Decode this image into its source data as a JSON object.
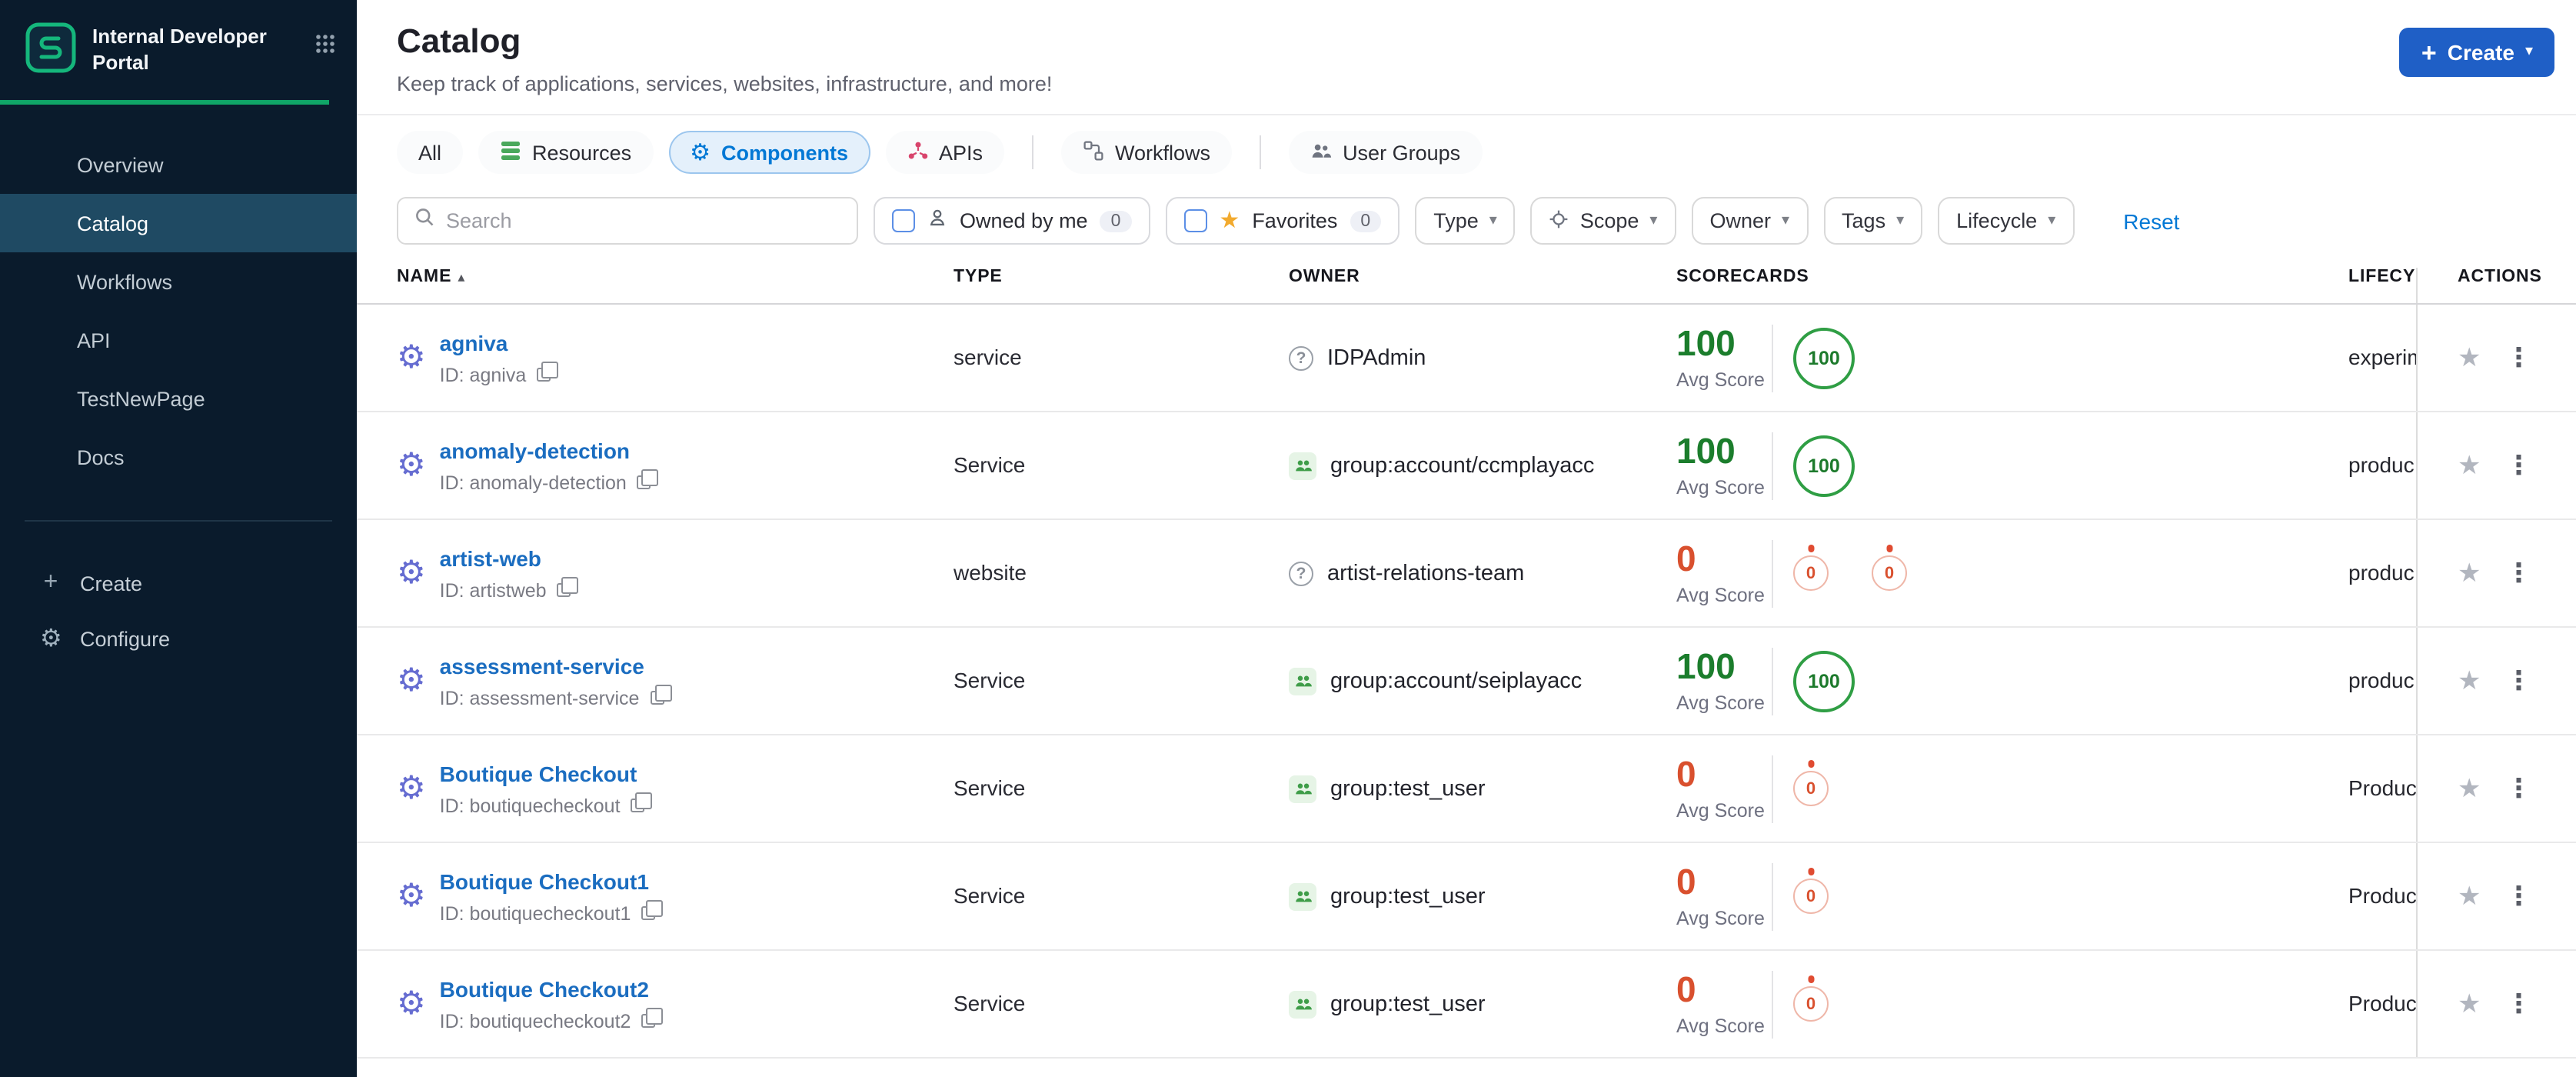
{
  "sidebar": {
    "logo_title_line1": "Internal Developer",
    "logo_title_line2": "Portal",
    "items": [
      {
        "label": "Overview",
        "active": false
      },
      {
        "label": "Catalog",
        "active": true
      },
      {
        "label": "Workflows",
        "active": false
      },
      {
        "label": "API",
        "active": false
      },
      {
        "label": "TestNewPage",
        "active": false
      },
      {
        "label": "Docs",
        "active": false
      }
    ],
    "create_label": "Create",
    "configure_label": "Configure"
  },
  "header": {
    "title": "Catalog",
    "subtitle": "Keep track of applications, services, websites, infrastructure, and more!",
    "create_button_label": "Create"
  },
  "tabs": [
    {
      "label": "All",
      "active": false
    },
    {
      "label": "Resources",
      "active": false
    },
    {
      "label": "Components",
      "active": true
    },
    {
      "label": "APIs",
      "active": false
    },
    {
      "label": "Workflows",
      "active": false
    },
    {
      "label": "User Groups",
      "active": false
    }
  ],
  "filters": {
    "search_placeholder": "Search",
    "owned_by_me": {
      "label": "Owned by me",
      "count": "0"
    },
    "favorites": {
      "label": "Favorites",
      "count": "0"
    },
    "dropdowns": [
      {
        "label": "Type"
      },
      {
        "label": "Scope"
      },
      {
        "label": "Owner"
      },
      {
        "label": "Tags"
      },
      {
        "label": "Lifecycle"
      }
    ],
    "reset_label": "Reset"
  },
  "table": {
    "columns": [
      "NAME",
      "TYPE",
      "OWNER",
      "SCORECARDS",
      "LIFECYC",
      "ACTIONS"
    ],
    "avg_score_label": "Avg Score",
    "rows": [
      {
        "name": "agniva",
        "id": "ID: agniva",
        "type": "service",
        "owner": "IDPAdmin",
        "owner_icon": "question",
        "avg_score": "100",
        "score_variant": "green",
        "badges": [
          {
            "value": "100",
            "variant": "green"
          }
        ],
        "lifecycle": "experim"
      },
      {
        "name": "anomaly-detection",
        "id": "ID: anomaly-detection",
        "type": "Service",
        "owner": "group:account/ccmplayacc",
        "owner_icon": "group",
        "avg_score": "100",
        "score_variant": "green",
        "badges": [
          {
            "value": "100",
            "variant": "green"
          }
        ],
        "lifecycle": "produc"
      },
      {
        "name": "artist-web",
        "id": "ID: artistweb",
        "type": "website",
        "owner": "artist-relations-team",
        "owner_icon": "question",
        "avg_score": "0",
        "score_variant": "red",
        "badges": [
          {
            "value": "0",
            "variant": "red"
          },
          {
            "value": "0",
            "variant": "red"
          }
        ],
        "lifecycle": "produc"
      },
      {
        "name": "assessment-service",
        "id": "ID: assessment-service",
        "type": "Service",
        "owner": "group:account/seiplayacc",
        "owner_icon": "group",
        "avg_score": "100",
        "score_variant": "green",
        "badges": [
          {
            "value": "100",
            "variant": "green"
          }
        ],
        "lifecycle": "produc"
      },
      {
        "name": "Boutique Checkout",
        "id": "ID: boutiquecheckout",
        "type": "Service",
        "owner": "group:test_user",
        "owner_icon": "group",
        "avg_score": "0",
        "score_variant": "red",
        "badges": [
          {
            "value": "0",
            "variant": "red"
          }
        ],
        "lifecycle": "Produc"
      },
      {
        "name": "Boutique Checkout1",
        "id": "ID: boutiquecheckout1",
        "type": "Service",
        "owner": "group:test_user",
        "owner_icon": "group",
        "avg_score": "0",
        "score_variant": "red",
        "badges": [
          {
            "value": "0",
            "variant": "red"
          }
        ],
        "lifecycle": "Produc"
      },
      {
        "name": "Boutique Checkout2",
        "id": "ID: boutiquecheckout2",
        "type": "Service",
        "owner": "group:test_user",
        "owner_icon": "group",
        "avg_score": "0",
        "score_variant": "red",
        "badges": [
          {
            "value": "0",
            "variant": "red"
          }
        ],
        "lifecycle": "Produc"
      }
    ]
  }
}
